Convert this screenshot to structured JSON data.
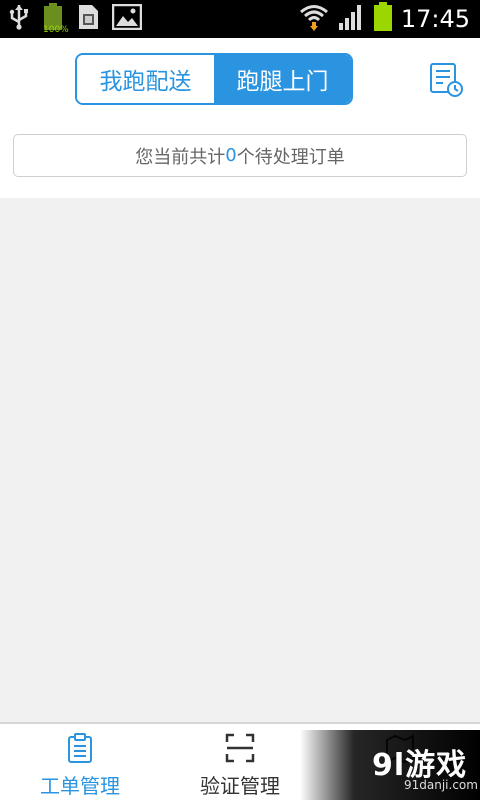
{
  "status_bar": {
    "battery_small_label": "100%",
    "time": "17:45"
  },
  "header": {
    "segmented": {
      "tabs": [
        {
          "label": "我跑配送",
          "active": false
        },
        {
          "label": "跑腿上门",
          "active": true
        }
      ]
    },
    "pending_banner": {
      "prefix": "您当前共计",
      "count": "0",
      "suffix": "个待处理订单"
    }
  },
  "bottom_nav": {
    "items": [
      {
        "label": "工单管理",
        "active": true,
        "icon": "clipboard-icon"
      },
      {
        "label": "验证管理",
        "active": false,
        "icon": "scan-icon"
      },
      {
        "label": "",
        "active": false,
        "icon": "map-icon"
      }
    ]
  },
  "watermark": {
    "logo": "9l游戏",
    "url": "91danji.com"
  },
  "colors": {
    "accent": "#2a94e0",
    "background": "#f1f1f1"
  }
}
